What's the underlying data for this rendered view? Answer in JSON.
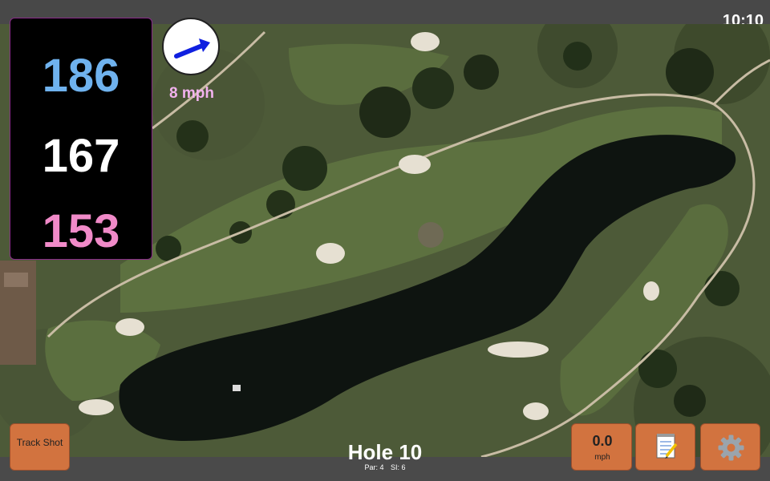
{
  "status_bar": {
    "time": "10:10"
  },
  "distances": {
    "back": "186",
    "middle": "167",
    "front": "153"
  },
  "wind": {
    "speed": "8 mph",
    "direction_icon": "arrow-icon"
  },
  "hole": {
    "title": "Hole 10",
    "par": "Par: 4",
    "si": "SI: 6"
  },
  "buttons": {
    "track_shot": "Track Shot",
    "speed_value": "0.0",
    "speed_unit": "mph",
    "notes_icon": "notepad-icon",
    "settings_icon": "gear-icon"
  },
  "colors": {
    "back_distance": "#6fb2ee",
    "middle_distance": "#ffffff",
    "front_distance": "#f08ac8",
    "button": "#d2733f",
    "wind_speed": "#f2b2ee"
  }
}
